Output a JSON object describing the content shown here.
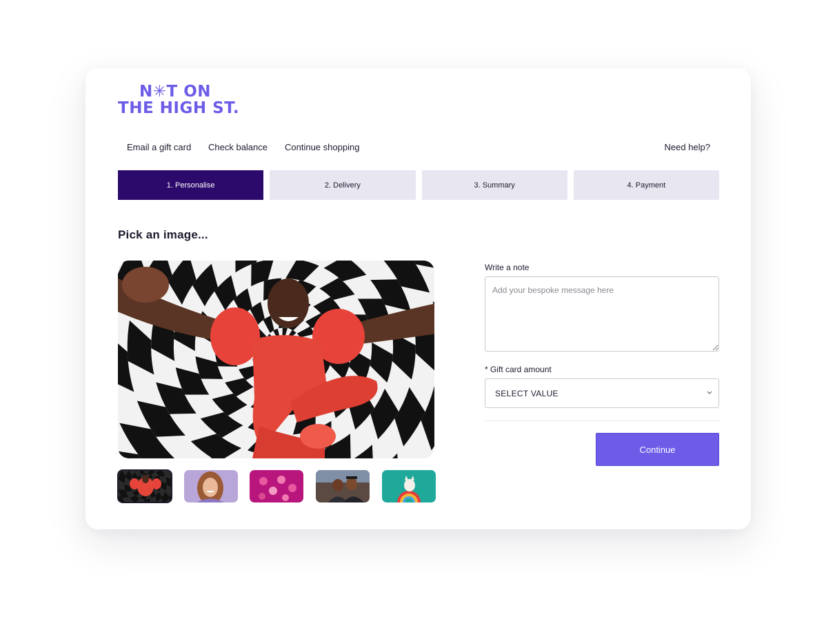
{
  "brand": {
    "logo_line1": "N✳T ON",
    "logo_line2": "THE HIGH ST.",
    "color": "#6c5ce7"
  },
  "topnav": {
    "email_gift_card": "Email a gift card",
    "check_balance": "Check balance",
    "continue_shopping": "Continue shopping",
    "need_help": "Need help?"
  },
  "steps": [
    {
      "label": "1. Personalise",
      "active": true
    },
    {
      "label": "2. Delivery",
      "active": false
    },
    {
      "label": "3. Summary",
      "active": false
    },
    {
      "label": "4. Payment",
      "active": false
    }
  ],
  "picker": {
    "title": "Pick an image...",
    "selected_index": 0,
    "thumbnails": [
      "hypnotic-spiral-dancer",
      "smiling-woman-lilac",
      "pink-smiley-badges",
      "graduation-selfie",
      "cat-on-rainbow"
    ]
  },
  "form": {
    "note_label": "Write a note",
    "note_placeholder": "Add your bespoke message here",
    "amount_label": "* Gift card amount",
    "amount_value": "SELECT VALUE",
    "continue_label": "Continue"
  },
  "colors": {
    "accent": "#6c5ce7",
    "active_step": "#2b0a6b",
    "inactive_step": "#e8e6f0"
  }
}
